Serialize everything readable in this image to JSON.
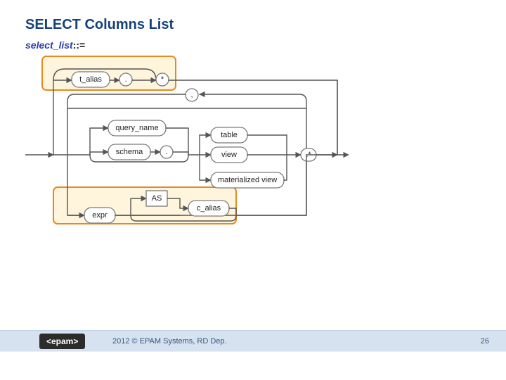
{
  "title": "SELECT Columns List",
  "rule": {
    "name": "select_list",
    "sep": "::="
  },
  "tokens": {
    "t_alias": "t_alias",
    "dot1": ".",
    "star_top": "*",
    "dot_loop": ",",
    "query_name": "query_name",
    "schema": "schema",
    "dot2": ".",
    "table": "table",
    "view": "view",
    "mview": "materialized view",
    "dot_star": ".*",
    "as": "AS",
    "c_alias": "c_alias",
    "expr": "expr"
  },
  "footer": {
    "logo": "<epam>",
    "copy": "2012 © EPAM Systems, RD Dep.",
    "page": "26"
  }
}
